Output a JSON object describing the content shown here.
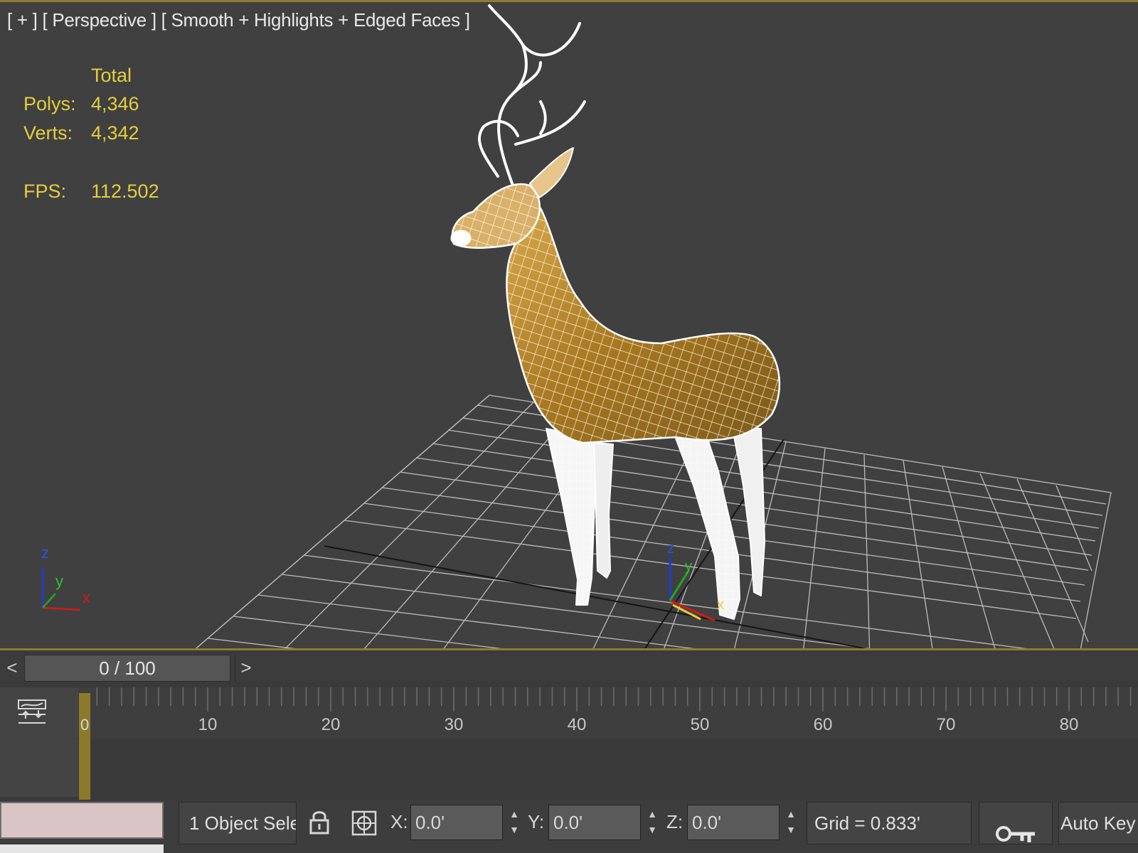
{
  "viewport": {
    "label": "[ + ] [ Perspective ] [ Smooth + Highlights + Edged Faces ]",
    "stats": {
      "header": "Total",
      "polys_label": "Polys:",
      "polys_value": "4,346",
      "verts_label": "Verts:",
      "verts_value": "4,342",
      "fps_label": "FPS:",
      "fps_value": "112.502"
    },
    "axis_labels": {
      "x": "x",
      "y": "y",
      "z": "z"
    }
  },
  "timeline": {
    "prev": "<",
    "next": ">",
    "slider": "0 / 100",
    "current_frame": "0",
    "ruler_ticks": [
      "10",
      "20",
      "30",
      "40",
      "50",
      "60",
      "70",
      "80"
    ]
  },
  "statusbar": {
    "selection": "1 Object Sele",
    "x_label": "X:",
    "x_value": "0.0'",
    "y_label": "Y:",
    "y_value": "0.0'",
    "z_label": "Z:",
    "z_value": "0.0'",
    "grid": "Grid = 0.833'",
    "auto_key": "Auto Key"
  },
  "colors": {
    "accent": "#8f7d2e",
    "stats": "#e3cf3e",
    "mesh_fill": "#b8862a",
    "wire": "#ffffff"
  },
  "icons": [
    "lock-icon",
    "absolute-mode-icon",
    "key-icon",
    "curve-editor-icon"
  ]
}
